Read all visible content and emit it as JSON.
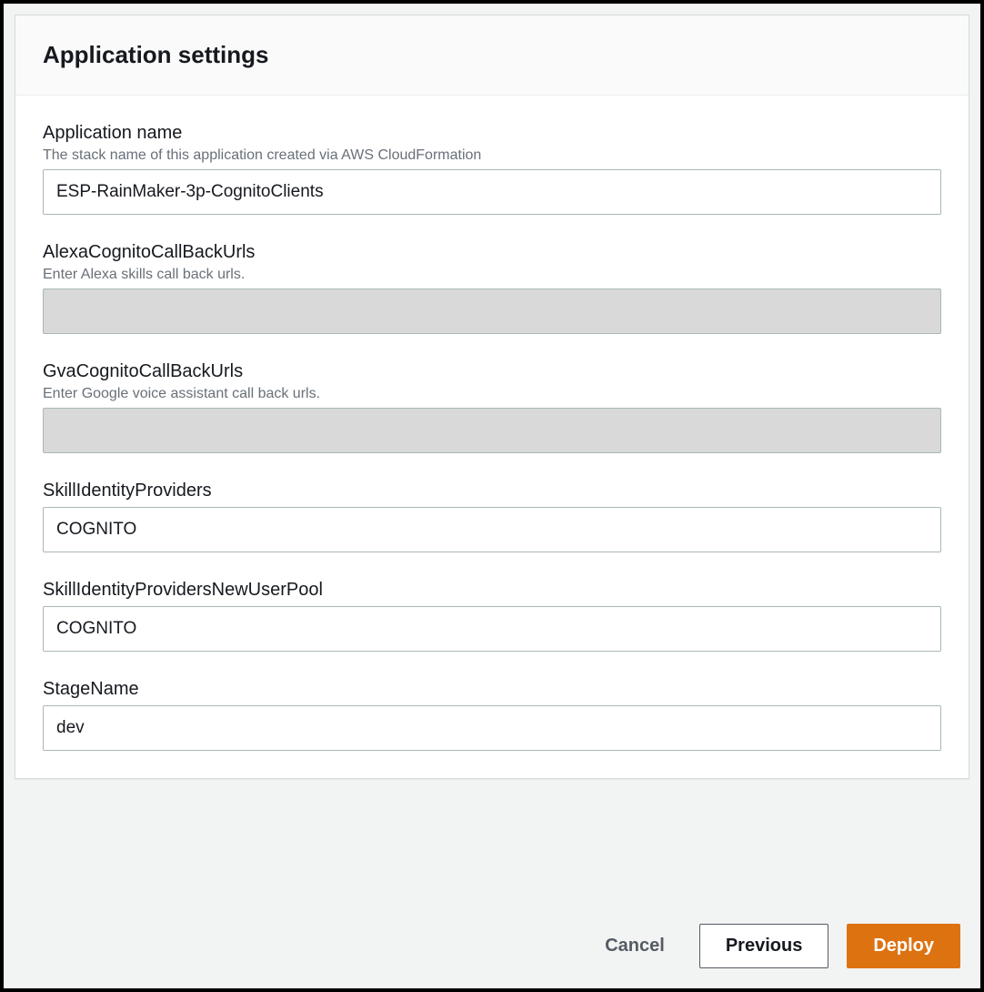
{
  "panel": {
    "title": "Application settings"
  },
  "fields": {
    "application_name": {
      "label": "Application name",
      "hint": "The stack name of this application created via AWS CloudFormation",
      "value": "ESP-RainMaker-3p-CognitoClients"
    },
    "alexa_callback": {
      "label": "AlexaCognitoCallBackUrls",
      "hint": "Enter Alexa skills call back urls.",
      "value": ""
    },
    "gva_callback": {
      "label": "GvaCognitoCallBackUrls",
      "hint": "Enter Google voice assistant call back urls.",
      "value": ""
    },
    "skill_identity_providers": {
      "label": "SkillIdentityProviders",
      "value": "COGNITO"
    },
    "skill_identity_providers_new": {
      "label": "SkillIdentityProvidersNewUserPool",
      "value": "COGNITO"
    },
    "stage_name": {
      "label": "StageName",
      "value": "dev"
    }
  },
  "buttons": {
    "cancel": "Cancel",
    "previous": "Previous",
    "deploy": "Deploy"
  }
}
